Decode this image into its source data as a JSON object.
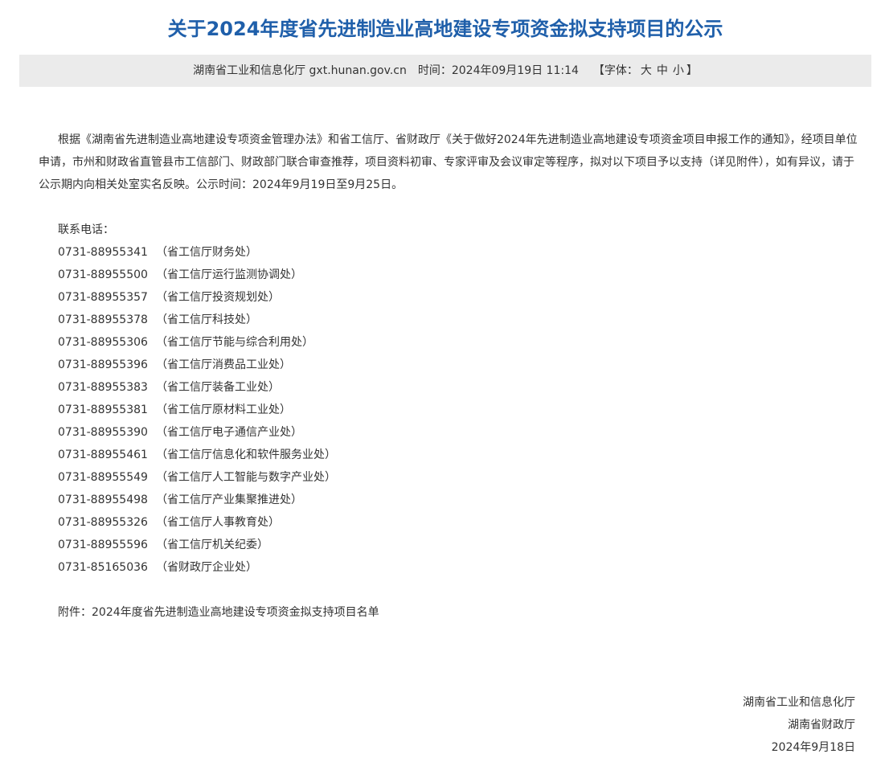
{
  "article": {
    "title": "关于2024年度省先进制造业高地建设专项资金拟支持项目的公示",
    "meta": {
      "source": "湖南省工业和信息化厅 gxt.hunan.gov.cn",
      "time_label": "时间：",
      "time": "2024年09月19日 11:14",
      "font_open": "【字体：",
      "font_large": "大",
      "font_medium": "中",
      "font_small": "小",
      "font_close": "】"
    },
    "paragraph": "根据《湖南省先进制造业高地建设专项资金管理办法》和省工信厅、省财政厅《关于做好2024年先进制造业高地建设专项资金项目申报工作的通知》，经项目单位申请，市州和财政省直管县市工信部门、财政部门联合审查推荐，项目资料初审、专家评审及会议审定等程序，拟对以下项目予以支持（详见附件），如有异议，请于公示期内向相关处室实名反映。公示时间：2024年9月19日至9月25日。",
    "contact_label": "联系电话：",
    "contacts": [
      {
        "phone": "0731-88955341",
        "dept": "（省工信厅财务处）"
      },
      {
        "phone": "0731-88955500",
        "dept": "（省工信厅运行监测协调处）"
      },
      {
        "phone": "0731-88955357",
        "dept": "（省工信厅投资规划处）"
      },
      {
        "phone": "0731-88955378",
        "dept": "（省工信厅科技处）"
      },
      {
        "phone": "0731-88955306",
        "dept": "（省工信厅节能与综合利用处）"
      },
      {
        "phone": "0731-88955396",
        "dept": "（省工信厅消费品工业处）"
      },
      {
        "phone": "0731-88955383",
        "dept": "（省工信厅装备工业处）"
      },
      {
        "phone": "0731-88955381",
        "dept": "（省工信厅原材料工业处）"
      },
      {
        "phone": "0731-88955390",
        "dept": "（省工信厅电子通信产业处）"
      },
      {
        "phone": "0731-88955461",
        "dept": "（省工信厅信息化和软件服务业处）"
      },
      {
        "phone": "0731-88955549",
        "dept": "（省工信厅人工智能与数字产业处）"
      },
      {
        "phone": "0731-88955498",
        "dept": "（省工信厅产业集聚推进处）"
      },
      {
        "phone": "0731-88955326",
        "dept": "（省工信厅人事教育处）"
      },
      {
        "phone": "0731-88955596",
        "dept": "（省工信厅机关纪委）"
      },
      {
        "phone": "0731-85165036",
        "dept": "（省财政厅企业处）"
      }
    ],
    "attachment_label": "附件：",
    "attachment_link": "2024年度省先进制造业高地建设专项资金拟支持项目名单",
    "signature": {
      "org1": "湖南省工业和信息化厅",
      "org2": "湖南省财政厅",
      "date": "2024年9月18日"
    }
  }
}
